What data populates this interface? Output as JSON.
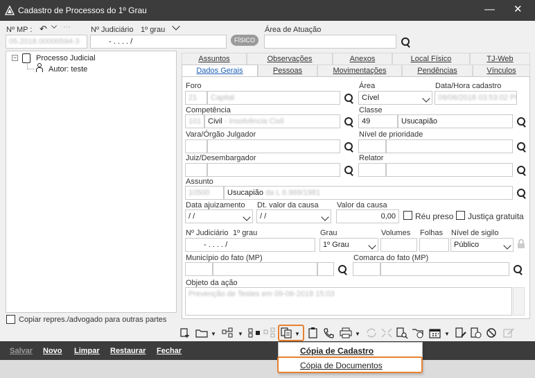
{
  "window": {
    "title": "Cadastro de Processos do 1º Grau"
  },
  "header": {
    "nmp_label": "Nº MP :",
    "nmp_value": "05.2018.00000594-3",
    "nj_label": "Nº Judiciário",
    "nj_grau": "1º grau",
    "nj_value": "- .  . . .  /",
    "fisico": "FÍSICO",
    "area_label": "Área de Atuação",
    "area_value": ""
  },
  "tree": {
    "root": "Processo Judicial",
    "child": "Autor: teste"
  },
  "copy_checkbox": "Copiar repres./advogado para outras partes",
  "tabs_row1": [
    "Assuntos",
    "Observações",
    "Anexos",
    "Local Físico",
    "TJ-Web"
  ],
  "tabs_row2": [
    "Dados Gerais",
    "Pessoas",
    "Movimentações",
    "Pendências",
    "Vínculos"
  ],
  "form": {
    "foro_label": "Foro",
    "foro_code": "21",
    "foro_name": "Capital",
    "area_label": "Área",
    "area_value": "Cível",
    "datahora_label": "Data/Hora cadastro",
    "datahora_value": "09/06/2018 03:53:02 PM",
    "competencia_label": "Competência",
    "competencia_code": "101",
    "competencia_name": "Civil",
    "competencia_extra": "- Insolvência Civil",
    "classe_label": "Classe",
    "classe_code": "49",
    "classe_name": "Usucapião",
    "vara_label": "Vara/Órgão Julgador",
    "prioridade_label": "Nível de prioridade",
    "juiz_label": "Juiz/Desembargador",
    "relator_label": "Relator",
    "assunto_label": "Assunto",
    "assunto_code": "10500",
    "assunto_name": "Usucapião",
    "assunto_extra": "da L 6.969/1981",
    "dataajuiz_label": "Data ajuizamento",
    "dataajuiz_value": " / /",
    "dtvalor_label": "Dt. valor da causa",
    "dtvalor_value": " / /",
    "valor_label": "Valor da causa",
    "valor_value": "0,00",
    "reu_preso": "Réu preso",
    "justica_gratuita": "Justiça gratuita",
    "nj2_label": "Nº Judiciário",
    "nj2_grau": "1º grau",
    "nj2_value": "- .  . . .  /",
    "grau_label": "Grau",
    "grau_value": "1º Grau",
    "volumes_label": "Volumes",
    "folhas_label": "Folhas",
    "sigilo_label": "Nível de sigilo",
    "sigilo_value": "Público",
    "municipio_label": "Município do fato (MP)",
    "comarca_label": "Comarca do fato (MP)",
    "objeto_label": "Objeto da ação",
    "objeto_value": "Prevenção de Testes em 09-06-2018 15:03"
  },
  "bottom_buttons": [
    "Salvar",
    "Novo",
    "Limpar",
    "Restaurar",
    "Fechar"
  ],
  "menu": {
    "item1": "Cópia de Cadastro",
    "item2": "Cópia de Documentos"
  },
  "colors": {
    "accent": "#e8802f",
    "titlebar": "#3c3c3c",
    "link": "#1f5fb5"
  }
}
